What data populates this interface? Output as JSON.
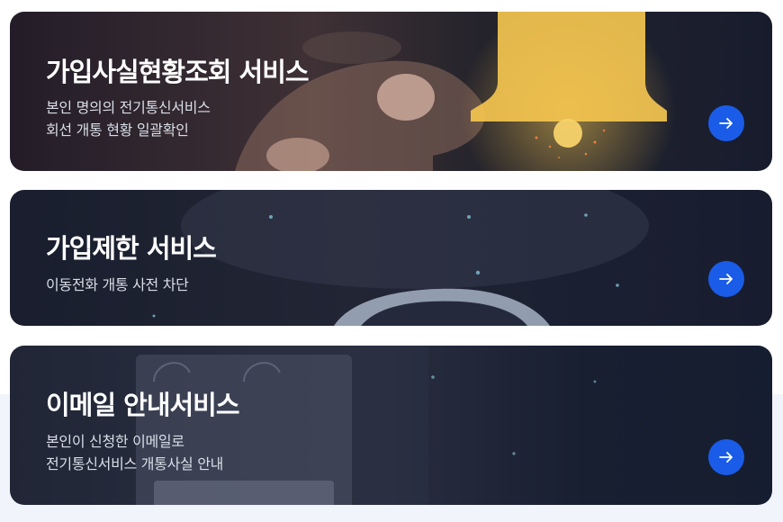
{
  "cards": [
    {
      "title": "가입사실현황조회 서비스",
      "desc_lines": [
        "본인 명의의 전기통신서비스",
        "회선 개통 현황 일괄확인"
      ],
      "arrow_icon": "arrow-right-icon"
    },
    {
      "title": "가입제한 서비스",
      "desc_lines": [
        "이동전화 개통 사전 차단"
      ],
      "arrow_icon": "arrow-right-icon"
    },
    {
      "title": "이메일 안내서비스",
      "desc_lines": [
        "본인이 신청한 이메일로",
        "전기통신서비스 개통사실 안내"
      ],
      "arrow_icon": "arrow-right-icon"
    }
  ],
  "colors": {
    "accent": "#1a5ce8",
    "card_text": "#ffffff",
    "desc_text": "#d9dee8",
    "bell_glow": "#f3c44f"
  }
}
